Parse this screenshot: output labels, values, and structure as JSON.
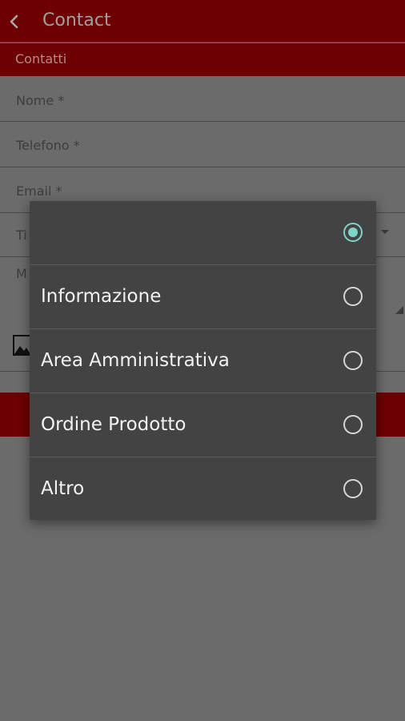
{
  "appbar": {
    "title": "Contact"
  },
  "section": {
    "label": "Contatti"
  },
  "form": {
    "fields": [
      {
        "label": "Nome *"
      },
      {
        "label": "Telefono *"
      },
      {
        "label": "Email *"
      },
      {
        "label": "Ti"
      },
      {
        "label": "M"
      }
    ]
  },
  "dialog": {
    "options": [
      {
        "label": "",
        "selected": true
      },
      {
        "label": "Informazione",
        "selected": false
      },
      {
        "label": "Area Amministrativa",
        "selected": false
      },
      {
        "label": "Ordine Prodotto",
        "selected": false
      },
      {
        "label": "Altro",
        "selected": false
      }
    ]
  },
  "colors": {
    "appbar": "#6d0000",
    "accent_radio": "#7fd3c9",
    "dialog_bg": "#434343"
  }
}
